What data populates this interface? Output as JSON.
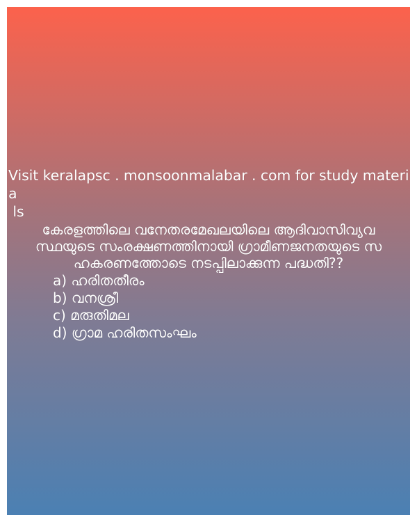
{
  "promo": {
    "text": "Visit keralapsc . monsoonmalabar . com for study materia\n ls"
  },
  "question": {
    "text": "കേരളത്തിലെ വനേതരമേഖലയിലെ ആദിവാസിവ്യവ\nസ്ഥയുടെ സംരക്ഷണത്തിനായി ഗ്രാമീണജനതയുടെ സ\nഹകരണത്തോടെ നടപ്പിലാക്കുന്ന പദ്ധതി??"
  },
  "options": [
    {
      "label": "a) ഹരിതതീരം"
    },
    {
      "label": "b) വനശ്രീ"
    },
    {
      "label": "c) മരുതിമല"
    },
    {
      "label": "d) ഗ്രാമ ഹരിതസംഘം"
    }
  ],
  "colors": {
    "gradient_top": "#fc624c",
    "gradient_middle": "#7f7b94",
    "gradient_bottom": "#4b80b3",
    "text": "#ffffff"
  }
}
